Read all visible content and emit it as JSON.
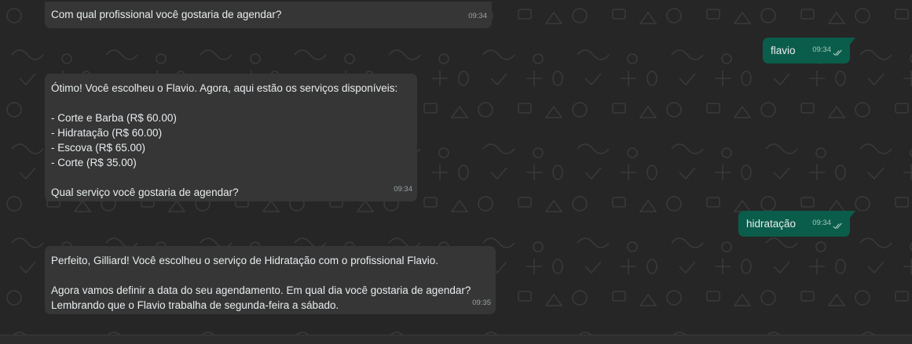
{
  "messages": [
    {
      "direction": "incoming",
      "text": "Com qual profissional você gostaria de agendar?",
      "time": "09:34"
    },
    {
      "direction": "outgoing",
      "text": "flavio",
      "time": "09:34",
      "status_icon": "double-check-icon"
    },
    {
      "direction": "incoming",
      "text": "Ótimo! Você escolheu o Flavio. Agora, aqui estão os serviços disponíveis:\n\n- Corte e Barba (R$ 60.00)\n- Hidratação (R$ 60.00)\n- Escova (R$ 65.00)\n- Corte (R$ 35.00)\n\nQual serviço você gostaria de agendar?",
      "time": "09:34"
    },
    {
      "direction": "outgoing",
      "text": "hidratação",
      "time": "09:34",
      "status_icon": "double-check-icon"
    },
    {
      "direction": "incoming",
      "text": "Perfeito, Gilliard! Você escolheu o serviço de Hidratação com o profissional Flavio.\n\nAgora vamos definir a data do seu agendamento. Em qual dia você gostaria de agendar?\nLembrando que o Flavio trabalha de segunda-feira a sábado.",
      "time": "09:35"
    }
  ],
  "colors": {
    "background": "#262626",
    "incoming_bubble": "#363636",
    "outgoing_bubble": "#0b5d4b",
    "text": "#e9edef",
    "timestamp": "#9aa3a6"
  }
}
